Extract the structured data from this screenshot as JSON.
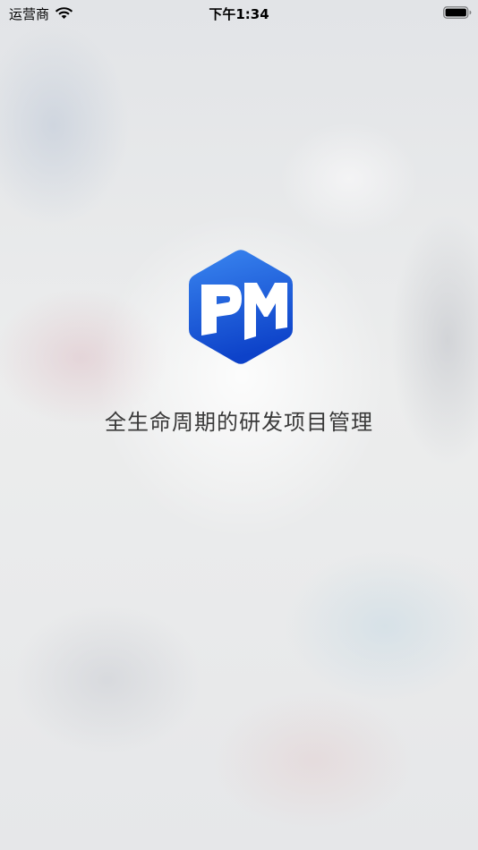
{
  "status_bar": {
    "carrier": "运营商",
    "time": "下午1:34"
  },
  "logo": {
    "text": "PM",
    "colors": {
      "top": "#3a86f0",
      "bottom": "#0d42c9"
    }
  },
  "slogan": "全生命周期的研发项目管理"
}
